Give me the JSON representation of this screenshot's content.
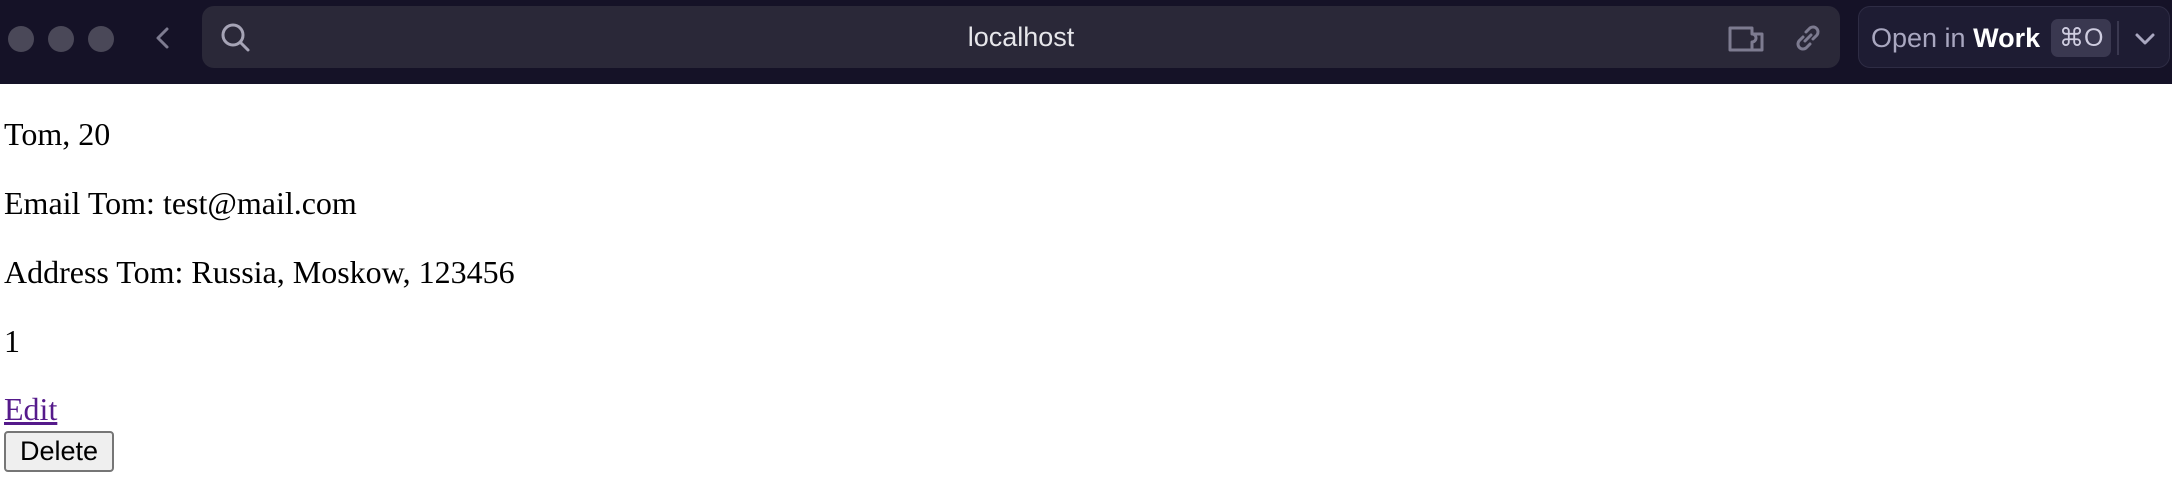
{
  "browser": {
    "url": "localhost",
    "open_in": {
      "prefix": "Open in",
      "target": "Work",
      "shortcut": "⌘O"
    },
    "icons": [
      "close-dot-icon",
      "minimize-dot-icon",
      "zoom-dot-icon",
      "chevron-left-icon",
      "search-icon",
      "extension-icon",
      "link-icon",
      "chevron-down-icon"
    ],
    "colors": {
      "toolbar": "#151227",
      "url_bar": "#2a2838",
      "visited_link": "#551a8b"
    }
  },
  "page": {
    "name_age": "Tom, 20",
    "email": "Email Tom: test@mail.com",
    "address": "Address Tom: Russia, Moskow, 123456",
    "id": "1",
    "edit_label": "Edit",
    "delete_label": "Delete"
  }
}
